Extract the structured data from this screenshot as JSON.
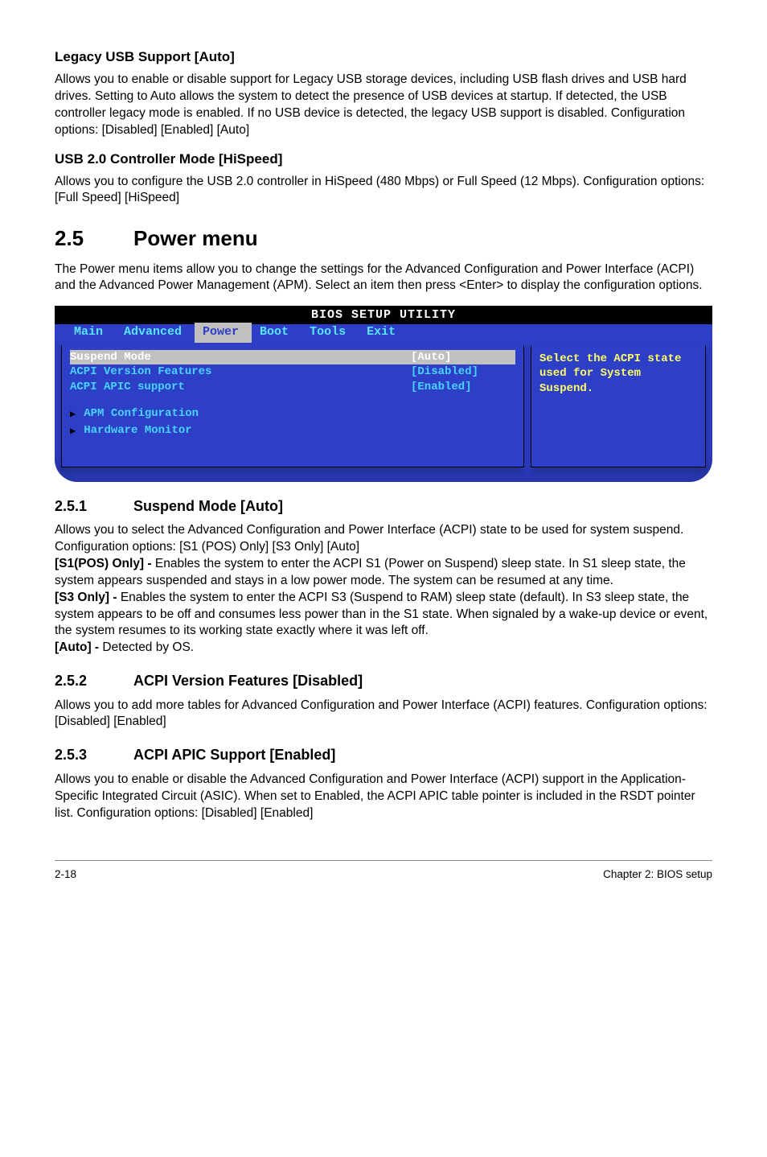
{
  "legacy_usb": {
    "heading": "Legacy USB Support [Auto]",
    "body": "Allows you to enable or disable support for Legacy USB storage devices, including USB flash drives and USB hard drives. Setting to Auto allows the system to detect the presence of USB devices at startup. If detected, the USB controller legacy mode is enabled. If no USB device is detected, the legacy USB support is disabled. Configuration options: [Disabled] [Enabled] [Auto]"
  },
  "usb20": {
    "heading": "USB 2.0 Controller Mode [HiSpeed]",
    "body": "Allows you to configure the USB 2.0 controller in HiSpeed (480 Mbps) or Full Speed (12 Mbps). Configuration options: [Full Speed] [HiSpeed]"
  },
  "power_menu": {
    "num": "2.5",
    "title": "Power menu",
    "body": "The Power menu items allow you to change the settings for the Advanced Configuration and Power Interface (ACPI) and the Advanced Power Management (APM). Select an item then press <Enter> to display the configuration options."
  },
  "bios": {
    "title": "BIOS SETUP UTILITY",
    "tabs": [
      "Main",
      "Advanced",
      "Power",
      "Boot",
      "Tools",
      "Exit"
    ],
    "active_tab_index": 2,
    "rows": [
      {
        "label": "Suspend Mode",
        "value": "[Auto]",
        "selected": true
      },
      {
        "label": "ACPI Version Features",
        "value": "[Disabled]",
        "selected": false
      },
      {
        "label": "ACPI APIC support",
        "value": "[Enabled]",
        "selected": false
      }
    ],
    "submenus": [
      "APM Configuration",
      "Hardware Monitor"
    ],
    "help": "Select the ACPI state used for System Suspend."
  },
  "s251": {
    "num": "2.5.1",
    "title": "Suspend Mode [Auto]",
    "p1": "Allows you to select the Advanced Configuration and Power Interface (ACPI) state to be used for system suspend. Configuration options: [S1 (POS) Only] [S3 Only] [Auto]",
    "s1_label": "[S1(POS) Only] - ",
    "s1_text": "Enables the system to enter the ACPI S1 (Power on Suspend) sleep state. In S1 sleep state, the system appears suspended and stays in a low power mode. The system can be resumed at any time.",
    "s3_label": "[S3 Only] - ",
    "s3_text": "Enables the system to enter the ACPI S3 (Suspend to RAM) sleep state (default). In S3 sleep state, the system appears to be off and consumes less power than in the S1 state. When signaled by a wake-up device or event, the system resumes to its working state exactly where it was left off.",
    "auto_label": "[Auto] - ",
    "auto_text": "Detected by OS."
  },
  "s252": {
    "num": "2.5.2",
    "title": "ACPI  Version Features [Disabled]",
    "body": "Allows you to add more tables for Advanced Configuration and Power Interface (ACPI) features. Configuration options: [Disabled] [Enabled]"
  },
  "s253": {
    "num": "2.5.3",
    "title": "ACPI APIC Support [Enabled]",
    "body": "Allows you to enable or disable the Advanced Configuration and Power Interface (ACPI) support in the Application-Specific Integrated Circuit (ASIC). When set to Enabled, the ACPI APIC table pointer is included in the RSDT pointer list. Configuration options: [Disabled] [Enabled]"
  },
  "footer": {
    "left": "2-18",
    "right": "Chapter 2: BIOS setup"
  }
}
